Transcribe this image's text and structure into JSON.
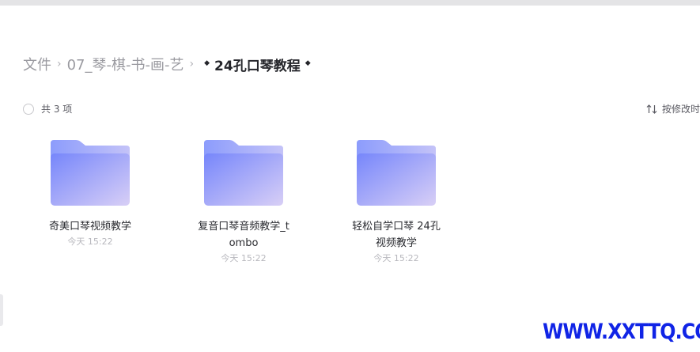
{
  "breadcrumb": {
    "root": "文件",
    "parent": "07_琴-棋-书-画-艺",
    "current": "24孔口琴教程"
  },
  "toolbar": {
    "count_label": "共 3 项",
    "sort_label": "按修改时"
  },
  "items": [
    {
      "name": "奇美口琴视频教学",
      "time": "今天 15:22",
      "icon": "folder-icon"
    },
    {
      "name": "复音口琴音频教学_tombo",
      "time": "今天 15:22",
      "icon": "folder-icon"
    },
    {
      "name": "轻松自学口琴 24孔视频教学",
      "time": "今天 15:22",
      "icon": "folder-icon"
    }
  ],
  "colors": {
    "folder_gradient_start": "#7b8cfb",
    "folder_gradient_end": "#d6cdf6",
    "watermark": "#1024e6"
  },
  "watermark": "WWW.XXTTQ.COM"
}
